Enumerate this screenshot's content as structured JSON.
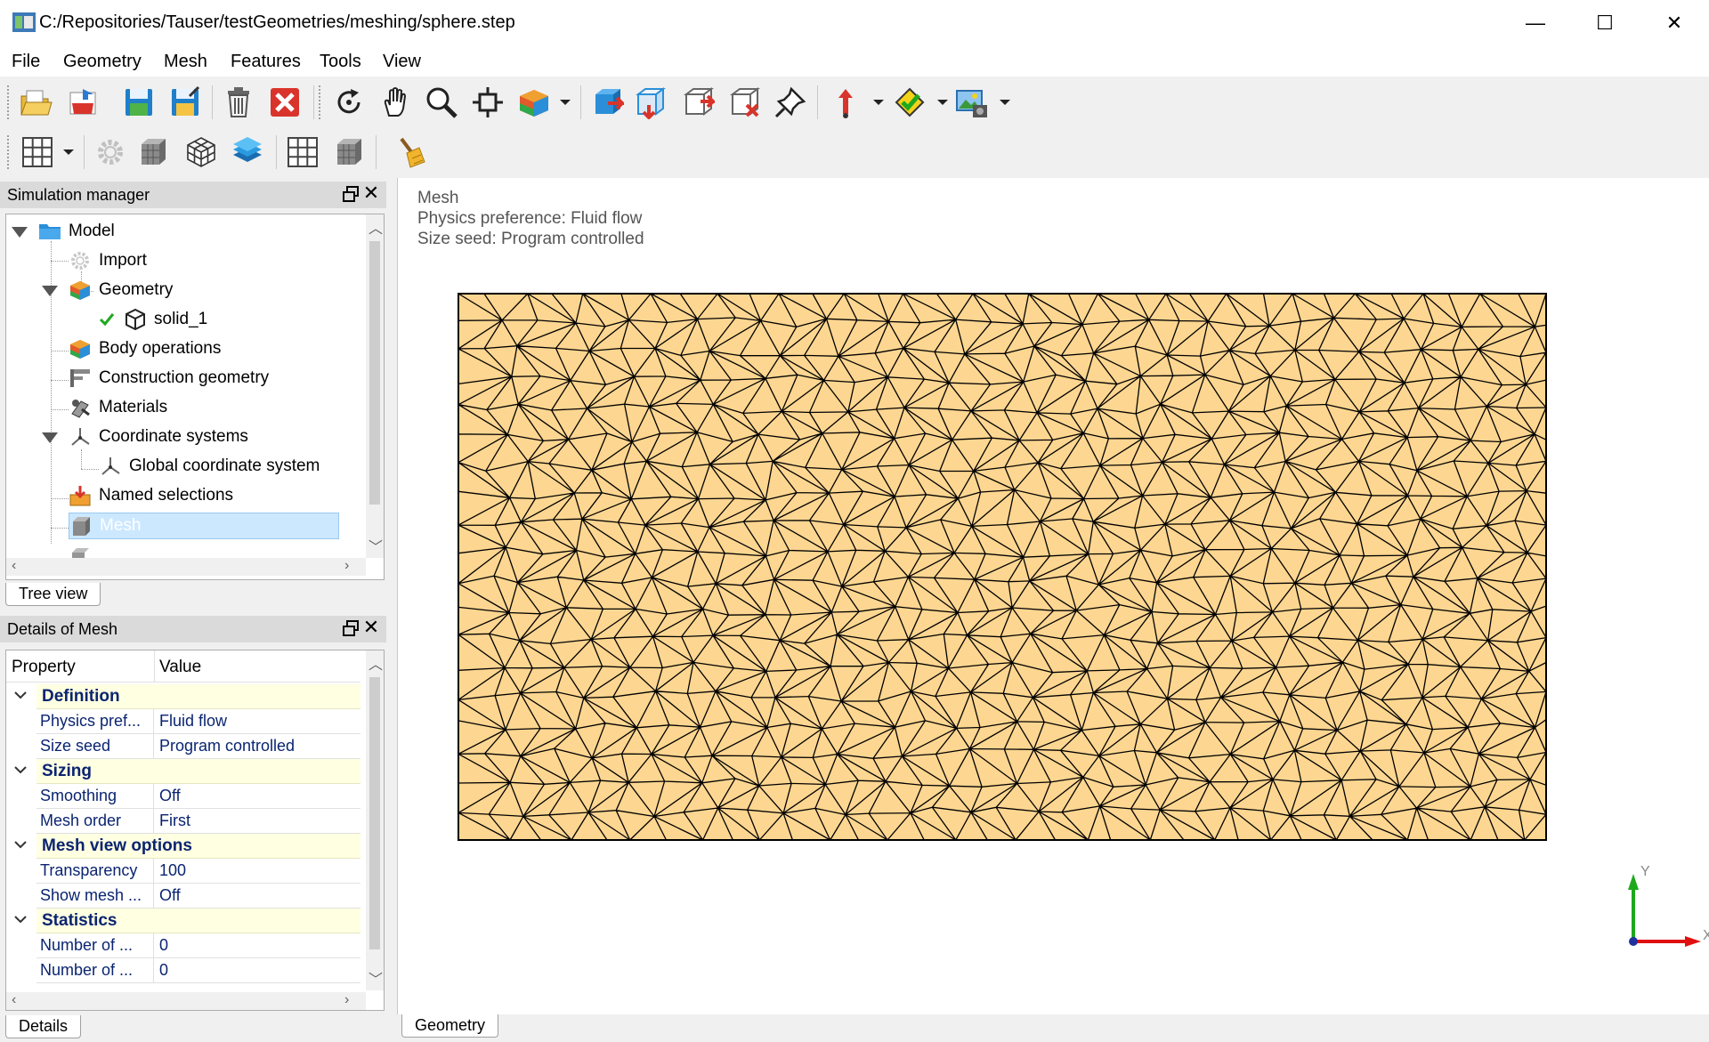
{
  "window": {
    "title": "C:/Repositories/Tauser/testGeometries/meshing/sphere.step",
    "minimize_glyph": "—",
    "maximize_glyph": "☐",
    "close_glyph": "✕"
  },
  "menubar": {
    "items": [
      "File",
      "Geometry",
      "Mesh",
      "Features",
      "Tools",
      "View"
    ]
  },
  "toolbar1": {
    "buttons": [
      "open-folder-icon",
      "import-icon",
      "save-icon",
      "save-as-icon",
      "delete-icon",
      "close-red-icon",
      "rotate-icon",
      "pan-hand-icon",
      "zoom-icon",
      "zoom-fit-icon",
      "body-color-icon",
      "select-face-icon",
      "select-edge-icon",
      "select-body-icon",
      "select-box-icon",
      "pin-icon",
      "arrow-up-icon",
      "check-diamond-icon",
      "screenshot-icon"
    ]
  },
  "toolbar2": {
    "buttons": [
      "grid-icon",
      "gear-icon",
      "mesh-cube-icon",
      "wire-cube-icon",
      "layers-icon",
      "grid-small-icon",
      "mesh-box-icon",
      "broom-icon"
    ]
  },
  "simulation_manager": {
    "title": "Simulation manager",
    "float_glyph": "🗗",
    "close_glyph": "✕",
    "tree": [
      {
        "label": "Model"
      },
      {
        "label": "Import"
      },
      {
        "label": "Geometry"
      },
      {
        "label": "solid_1"
      },
      {
        "label": "Body operations"
      },
      {
        "label": "Construction geometry"
      },
      {
        "label": "Materials"
      },
      {
        "label": "Coordinate systems"
      },
      {
        "label": "Global coordinate system"
      },
      {
        "label": "Named selections"
      },
      {
        "label": "Mesh"
      }
    ],
    "tab_label": "Tree view"
  },
  "details": {
    "title": "Details of Mesh",
    "float_glyph": "🗗",
    "close_glyph": "✕",
    "header_property": "Property",
    "header_value": "Value",
    "categories": [
      {
        "label": "Definition",
        "rows": [
          {
            "name": "Physics pref...",
            "value": "Fluid flow"
          },
          {
            "name": "Size seed",
            "value": "Program controlled"
          }
        ]
      },
      {
        "label": "Sizing",
        "rows": [
          {
            "name": "Smoothing",
            "value": "Off"
          },
          {
            "name": "Mesh order",
            "value": "First"
          }
        ]
      },
      {
        "label": "Mesh view options",
        "rows": [
          {
            "name": "Transparency",
            "value": "100"
          },
          {
            "name": "Show mesh ...",
            "value": "Off"
          }
        ]
      },
      {
        "label": "Statistics",
        "rows": [
          {
            "name": "Number of ...",
            "value": "0"
          },
          {
            "name": "Number of ...",
            "value": "0"
          }
        ]
      }
    ],
    "tab_label": "Details"
  },
  "viewport": {
    "info_lines": [
      "Mesh",
      "Physics preference: Fluid flow",
      "Size seed: Program controlled"
    ],
    "mesh_fill": "#fdd691",
    "mesh_stroke": "#000000",
    "axis_y_label": "Y",
    "axis_x_label": "X",
    "axis_y_color": "#1ea81e",
    "axis_x_color": "#e01010",
    "tab_label": "Geometry"
  }
}
